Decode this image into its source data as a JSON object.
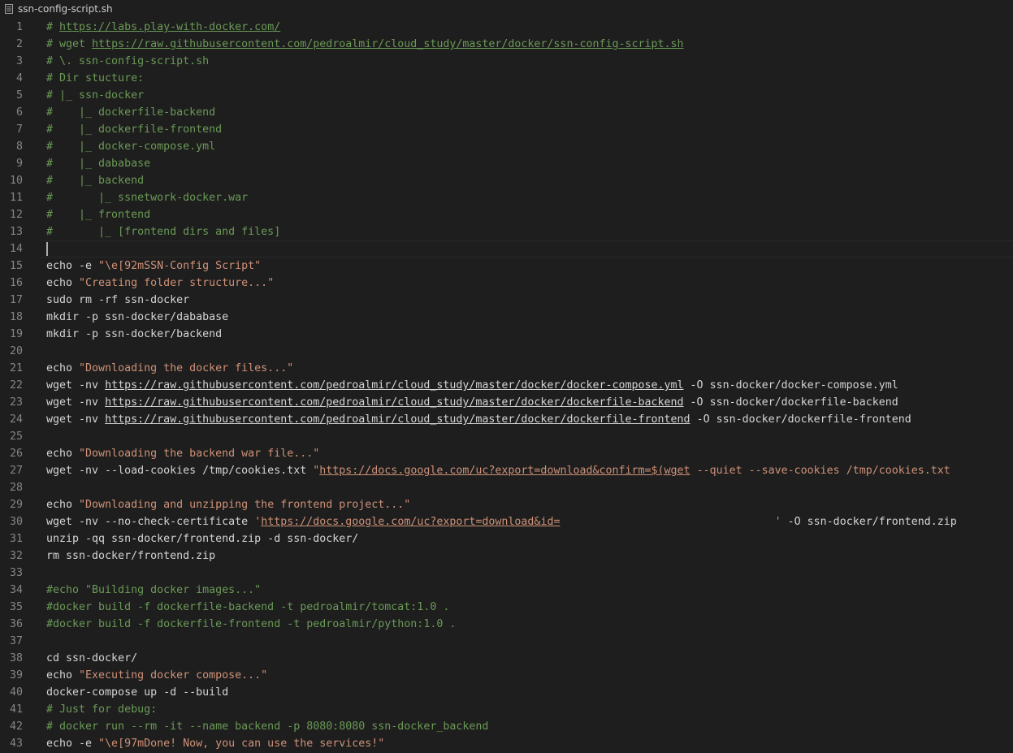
{
  "tab": {
    "title": "ssn-config-script.sh",
    "icon": "file-lines-icon"
  },
  "colors": {
    "background": "#1e1e1e",
    "comment": "#6a9955",
    "string": "#ce9178",
    "plain": "#d4d4d4",
    "line_number": "#858585"
  },
  "editor": {
    "current_line": 14,
    "lines": [
      {
        "n": "1",
        "t": [
          [
            "c",
            "# "
          ],
          [
            "cu",
            "https://labs.play-with-docker.com/"
          ]
        ]
      },
      {
        "n": "2",
        "t": [
          [
            "c",
            "# wget "
          ],
          [
            "cu",
            "https://raw.githubusercontent.com/pedroalmir/cloud_study/master/docker/ssn-config-script.sh"
          ]
        ]
      },
      {
        "n": "3",
        "t": [
          [
            "c",
            "# \\. ssn-config-script.sh"
          ]
        ]
      },
      {
        "n": "4",
        "t": [
          [
            "c",
            "# Dir stucture:"
          ]
        ]
      },
      {
        "n": "5",
        "t": [
          [
            "c",
            "# |_ ssn-docker"
          ]
        ]
      },
      {
        "n": "6",
        "t": [
          [
            "c",
            "#    |_ dockerfile-backend"
          ]
        ]
      },
      {
        "n": "7",
        "t": [
          [
            "c",
            "#    |_ dockerfile-frontend"
          ]
        ]
      },
      {
        "n": "8",
        "t": [
          [
            "c",
            "#    |_ docker-compose.yml"
          ]
        ]
      },
      {
        "n": "9",
        "t": [
          [
            "c",
            "#    |_ dababase"
          ]
        ]
      },
      {
        "n": "10",
        "t": [
          [
            "c",
            "#    |_ backend"
          ]
        ]
      },
      {
        "n": "11",
        "t": [
          [
            "c",
            "#       |_ ssnetwork-docker.war"
          ]
        ]
      },
      {
        "n": "12",
        "t": [
          [
            "c",
            "#    |_ frontend"
          ]
        ]
      },
      {
        "n": "13",
        "t": [
          [
            "c",
            "#       |_ [frontend dirs and files]"
          ]
        ]
      },
      {
        "n": "14",
        "t": []
      },
      {
        "n": "15",
        "t": [
          [
            "p",
            "echo -e "
          ],
          [
            "s",
            "\"\\e[92mSSN-Config Script\""
          ]
        ]
      },
      {
        "n": "16",
        "t": [
          [
            "p",
            "echo "
          ],
          [
            "s",
            "\"Creating folder structure...\""
          ]
        ]
      },
      {
        "n": "17",
        "t": [
          [
            "p",
            "sudo rm -rf ssn-docker"
          ]
        ]
      },
      {
        "n": "18",
        "t": [
          [
            "p",
            "mkdir -p ssn-docker/dababase"
          ]
        ]
      },
      {
        "n": "19",
        "t": [
          [
            "p",
            "mkdir -p ssn-docker/backend"
          ]
        ]
      },
      {
        "n": "20",
        "t": []
      },
      {
        "n": "21",
        "t": [
          [
            "p",
            "echo "
          ],
          [
            "s",
            "\"Downloading the docker files...\""
          ]
        ]
      },
      {
        "n": "22",
        "t": [
          [
            "p",
            "wget -nv "
          ],
          [
            "pu",
            "https://raw.githubusercontent.com/pedroalmir/cloud_study/master/docker/docker-compose.yml"
          ],
          [
            "p",
            " -O ssn-docker/docker-compose.yml"
          ]
        ]
      },
      {
        "n": "23",
        "t": [
          [
            "p",
            "wget -nv "
          ],
          [
            "pu",
            "https://raw.githubusercontent.com/pedroalmir/cloud_study/master/docker/dockerfile-backend"
          ],
          [
            "p",
            " -O ssn-docker/dockerfile-backend"
          ]
        ]
      },
      {
        "n": "24",
        "t": [
          [
            "p",
            "wget -nv "
          ],
          [
            "pu",
            "https://raw.githubusercontent.com/pedroalmir/cloud_study/master/docker/dockerfile-frontend"
          ],
          [
            "p",
            " -O ssn-docker/dockerfile-frontend"
          ]
        ]
      },
      {
        "n": "25",
        "t": []
      },
      {
        "n": "26",
        "t": [
          [
            "p",
            "echo "
          ],
          [
            "s",
            "\"Downloading the backend war file...\""
          ]
        ]
      },
      {
        "n": "27",
        "t": [
          [
            "p",
            "wget -nv --load-cookies /tmp/cookies.txt "
          ],
          [
            "s",
            "\""
          ],
          [
            "su",
            "https://docs.google.com/uc?export=download&confirm=$(wget"
          ],
          [
            "s",
            " --quiet --save-cookies /tmp/cookies.txt"
          ]
        ]
      },
      {
        "n": "28",
        "t": []
      },
      {
        "n": "29",
        "t": [
          [
            "p",
            "echo "
          ],
          [
            "s",
            "\"Downloading and unzipping the frontend project...\""
          ]
        ]
      },
      {
        "n": "30",
        "t": [
          [
            "p",
            "wget -nv --no-check-certificate "
          ],
          [
            "s",
            "'"
          ],
          [
            "su",
            "https://docs.google.com/uc?export=download&id="
          ],
          [
            "s",
            "                                 '"
          ],
          [
            "p",
            " -O ssn-docker/frontend.zip"
          ]
        ]
      },
      {
        "n": "31",
        "t": [
          [
            "p",
            "unzip -qq ssn-docker/frontend.zip -d ssn-docker/"
          ]
        ]
      },
      {
        "n": "32",
        "t": [
          [
            "p",
            "rm ssn-docker/frontend.zip"
          ]
        ]
      },
      {
        "n": "33",
        "t": []
      },
      {
        "n": "34",
        "t": [
          [
            "c",
            "#echo \"Building docker images...\""
          ]
        ]
      },
      {
        "n": "35",
        "t": [
          [
            "c",
            "#docker build -f dockerfile-backend -t pedroalmir/tomcat:1.0 ."
          ]
        ]
      },
      {
        "n": "36",
        "t": [
          [
            "c",
            "#docker build -f dockerfile-frontend -t pedroalmir/python:1.0 ."
          ]
        ]
      },
      {
        "n": "37",
        "t": []
      },
      {
        "n": "38",
        "t": [
          [
            "p",
            "cd ssn-docker/"
          ]
        ]
      },
      {
        "n": "39",
        "t": [
          [
            "p",
            "echo "
          ],
          [
            "s",
            "\"Executing docker compose...\""
          ]
        ]
      },
      {
        "n": "40",
        "t": [
          [
            "p",
            "docker-compose up -d --build"
          ]
        ]
      },
      {
        "n": "41",
        "t": [
          [
            "c",
            "# Just for debug:"
          ]
        ]
      },
      {
        "n": "42",
        "t": [
          [
            "c",
            "# docker run --rm -it --name backend -p 8080:8080 ssn-docker_backend"
          ]
        ]
      },
      {
        "n": "43",
        "t": [
          [
            "p",
            "echo -e "
          ],
          [
            "s",
            "\"\\e[97mDone! Now, you can use the services!\""
          ]
        ]
      }
    ]
  }
}
